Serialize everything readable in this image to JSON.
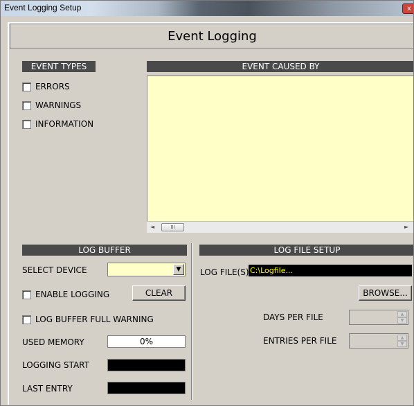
{
  "window": {
    "title": "Event Logging Setup",
    "close_glyph": "x"
  },
  "header": {
    "title": "Event Logging"
  },
  "event_types": {
    "title": "EVENT TYPES",
    "items": [
      {
        "label": "ERRORS",
        "checked": false
      },
      {
        "label": "WARNINGS",
        "checked": false
      },
      {
        "label": "INFORMATION",
        "checked": false
      }
    ]
  },
  "event_caused_by": {
    "title": "EVENT CAUSED BY",
    "background_color": "#ffffc8",
    "scroll_left": "◄",
    "scroll_right": "►",
    "scroll_thumb": "III"
  },
  "log_buffer": {
    "title": "LOG BUFFER",
    "select_device_label": "SELECT DEVICE",
    "select_device_value": "",
    "dropdown_glyph": "▼",
    "enable_logging_label": "ENABLE LOGGING",
    "clear_button": "CLEAR",
    "full_warning_label": "LOG BUFFER FULL WARNING",
    "used_memory_label": "USED MEMORY",
    "used_memory_value": "0%",
    "logging_start_label": "LOGGING START",
    "logging_start_value": "",
    "last_entry_label": "LAST ENTRY",
    "last_entry_value": ""
  },
  "log_file_setup": {
    "title": "LOG FILE SETUP",
    "log_files_label": "LOG FILE(S)",
    "log_files_value": "C:\\Logfile...",
    "browse_button": "BROWSE...",
    "days_per_file_label": "DAYS PER FILE",
    "days_per_file_value": "",
    "entries_per_file_label": "ENTRIES PER FILE",
    "entries_per_file_value": "",
    "spin_up": "▲",
    "spin_down": "▼"
  },
  "colors": {
    "panel": "#d4d0c8",
    "section_bar": "#4a4a4a",
    "log_file_text": "#ffff00"
  }
}
